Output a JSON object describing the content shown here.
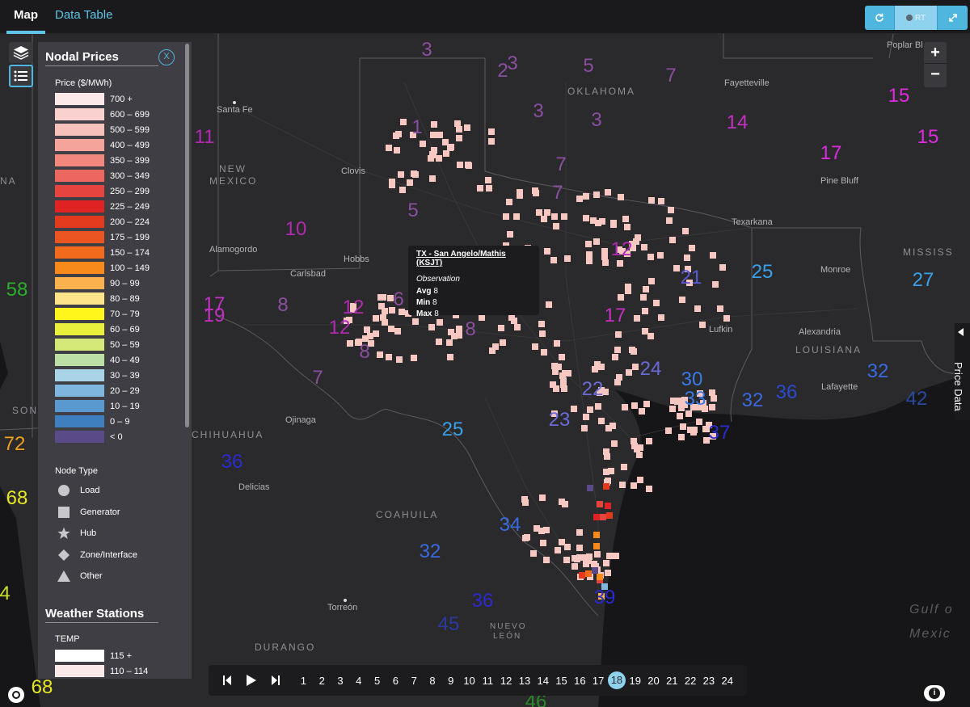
{
  "tabs": {
    "map": "Map",
    "data_table": "Data Table"
  },
  "toolbar": {
    "rt_label": "RT",
    "refresh_icon": "refresh-icon",
    "expand_icon": "expand-icon"
  },
  "legend": {
    "nodal_title": "Nodal Prices",
    "close_label": "X",
    "price_label": "Price ($/MWh)",
    "price_bins": [
      {
        "label": "700 +",
        "color": "#fbe9e9"
      },
      {
        "label": "600 – 699",
        "color": "#f9d2cf"
      },
      {
        "label": "500 – 599",
        "color": "#f7c1bb"
      },
      {
        "label": "400 – 499",
        "color": "#f4a49b"
      },
      {
        "label": "350 – 399",
        "color": "#f1877d"
      },
      {
        "label": "300 – 349",
        "color": "#ec675f"
      },
      {
        "label": "250 – 299",
        "color": "#e5443f"
      },
      {
        "label": "225 – 249",
        "color": "#df2322"
      },
      {
        "label": "200 – 224",
        "color": "#e23a1d"
      },
      {
        "label": "175 – 199",
        "color": "#ea5420"
      },
      {
        "label": "150 – 174",
        "color": "#f26a1b"
      },
      {
        "label": "100 – 149",
        "color": "#f8891b"
      },
      {
        "label": "90 – 99",
        "color": "#fbb14d"
      },
      {
        "label": "80 – 89",
        "color": "#fde38a"
      },
      {
        "label": "70 – 79",
        "color": "#fff61b"
      },
      {
        "label": "60 – 69",
        "color": "#e8f03d"
      },
      {
        "label": "50 – 59",
        "color": "#d4e878"
      },
      {
        "label": "40 – 49",
        "color": "#bcdfa6"
      },
      {
        "label": "30 – 39",
        "color": "#a9d3e6"
      },
      {
        "label": "20 – 29",
        "color": "#7eb6de"
      },
      {
        "label": "10 – 19",
        "color": "#5a99d0"
      },
      {
        "label": "0 – 9",
        "color": "#3f7fbf"
      },
      {
        "label": "< 0",
        "color": "#5b4a88"
      }
    ],
    "node_type_label": "Node Type",
    "node_types": [
      "Load",
      "Generator",
      "Hub",
      "Zone/Interface",
      "Other"
    ],
    "weather_title": "Weather Stations",
    "temp_label": "TEMP",
    "temp_bins": [
      {
        "label": "115 +",
        "color": "#ffffff"
      },
      {
        "label": "110 – 114",
        "color": "#fbe9e9"
      }
    ]
  },
  "tooltip": {
    "title": "TX - San Angelo/Mathis (KSJT)",
    "subtitle": "Observation",
    "avg_label": "Avg",
    "avg_value": "8",
    "min_label": "Min",
    "min_value": "8",
    "max_label": "Max",
    "max_value": "8"
  },
  "zoom": {
    "in": "+",
    "out": "−"
  },
  "side_tab": {
    "label": "Price Data"
  },
  "timeline": {
    "hours": [
      "1",
      "2",
      "3",
      "4",
      "5",
      "6",
      "7",
      "8",
      "9",
      "10",
      "11",
      "12",
      "13",
      "14",
      "15",
      "16",
      "17",
      "18",
      "19",
      "20",
      "21",
      "22",
      "23",
      "24"
    ],
    "active_hour": "18"
  },
  "places": [
    "Santa Fe",
    "Clovis",
    "Alamogordo",
    "Hobbs",
    "Carlsbad",
    "Ojinaga",
    "Delicias",
    "Torreón",
    "Fayetteville",
    "Pine Bluff",
    "Texarkana",
    "Monroe",
    "Lufkin",
    "Alexandria",
    "Lafayette",
    "Poplar Bl"
  ],
  "regions": [
    "OKLAHOMA",
    "NEW",
    "MEXICO",
    "LOUISIANA",
    "MISSISS",
    "COAHUILA",
    "CHIHUAHUA",
    "DURANGO",
    "NUEVO",
    "LEÓN",
    "NA",
    "SON",
    "Gulf o",
    "Mexic"
  ],
  "weather_values": [
    {
      "v": "3",
      "c": "#8a4fa0"
    },
    {
      "v": "2",
      "c": "#8a4fa0"
    },
    {
      "v": "3",
      "c": "#8a4fa0"
    },
    {
      "v": "5",
      "c": "#8a4fa0"
    },
    {
      "v": "7",
      "c": "#8a4fa0"
    },
    {
      "v": "3",
      "c": "#8a4fa0"
    },
    {
      "v": "3",
      "c": "#8a4fa0"
    },
    {
      "v": "1",
      "c": "#8a4fa0"
    },
    {
      "v": "14",
      "c": "#c42fc4"
    },
    {
      "v": "15",
      "c": "#e02ae0"
    },
    {
      "v": "15",
      "c": "#e02ae0"
    },
    {
      "v": "17",
      "c": "#e02ae0"
    },
    {
      "v": "11",
      "c": "#b02ab0"
    },
    {
      "v": "7",
      "c": "#8a4fa0"
    },
    {
      "v": "7",
      "c": "#8a4fa0"
    },
    {
      "v": "5",
      "c": "#8a4fa0"
    },
    {
      "v": "10",
      "c": "#b02ab0"
    },
    {
      "v": "12",
      "c": "#b02ab0"
    },
    {
      "v": "21",
      "c": "#5a5ad8"
    },
    {
      "v": "25",
      "c": "#3aa0e8"
    },
    {
      "v": "27",
      "c": "#3aa0e8"
    },
    {
      "v": "58",
      "c": "#2ab02a"
    },
    {
      "v": "17",
      "c": "#c42fc4"
    },
    {
      "v": "19",
      "c": "#c42fc4"
    },
    {
      "v": "8",
      "c": "#8a4fa0"
    },
    {
      "v": "12",
      "c": "#b02ab0"
    },
    {
      "v": "6",
      "c": "#8a4fa0"
    },
    {
      "v": "12",
      "c": "#b02ab0"
    },
    {
      "v": "8",
      "c": "#8a4fa0"
    },
    {
      "v": "7",
      "c": "#8a4fa0"
    },
    {
      "v": "8",
      "c": "#8a4fa0"
    },
    {
      "v": "17",
      "c": "#c42fc4"
    },
    {
      "v": "24",
      "c": "#6a6ad8"
    },
    {
      "v": "30",
      "c": "#3a7ae8"
    },
    {
      "v": "22",
      "c": "#6a6ad8"
    },
    {
      "v": "33",
      "c": "#3a7ae8"
    },
    {
      "v": "32",
      "c": "#3a6ae0"
    },
    {
      "v": "36",
      "c": "#2a4ad0"
    },
    {
      "v": "32",
      "c": "#3a6ae0"
    },
    {
      "v": "42",
      "c": "#2a4aa0"
    },
    {
      "v": "37",
      "c": "#2a2ad0"
    },
    {
      "v": "23",
      "c": "#6a6ad8"
    },
    {
      "v": "25",
      "c": "#3aa0e8"
    },
    {
      "v": "72",
      "c": "#f0a020"
    },
    {
      "v": "36",
      "c": "#2a2ad0"
    },
    {
      "v": "68",
      "c": "#e8e820"
    },
    {
      "v": "32",
      "c": "#3a6ae0"
    },
    {
      "v": "34",
      "c": "#3a6ae0"
    },
    {
      "v": "4",
      "c": "#c8e028"
    },
    {
      "v": "36",
      "c": "#2a2ad0"
    },
    {
      "v": "39",
      "c": "#2a2ad0"
    },
    {
      "v": "45",
      "c": "#2a3aa0"
    },
    {
      "v": "68",
      "c": "#e8e820"
    },
    {
      "v": "46",
      "c": "#2a8a2a"
    }
  ]
}
